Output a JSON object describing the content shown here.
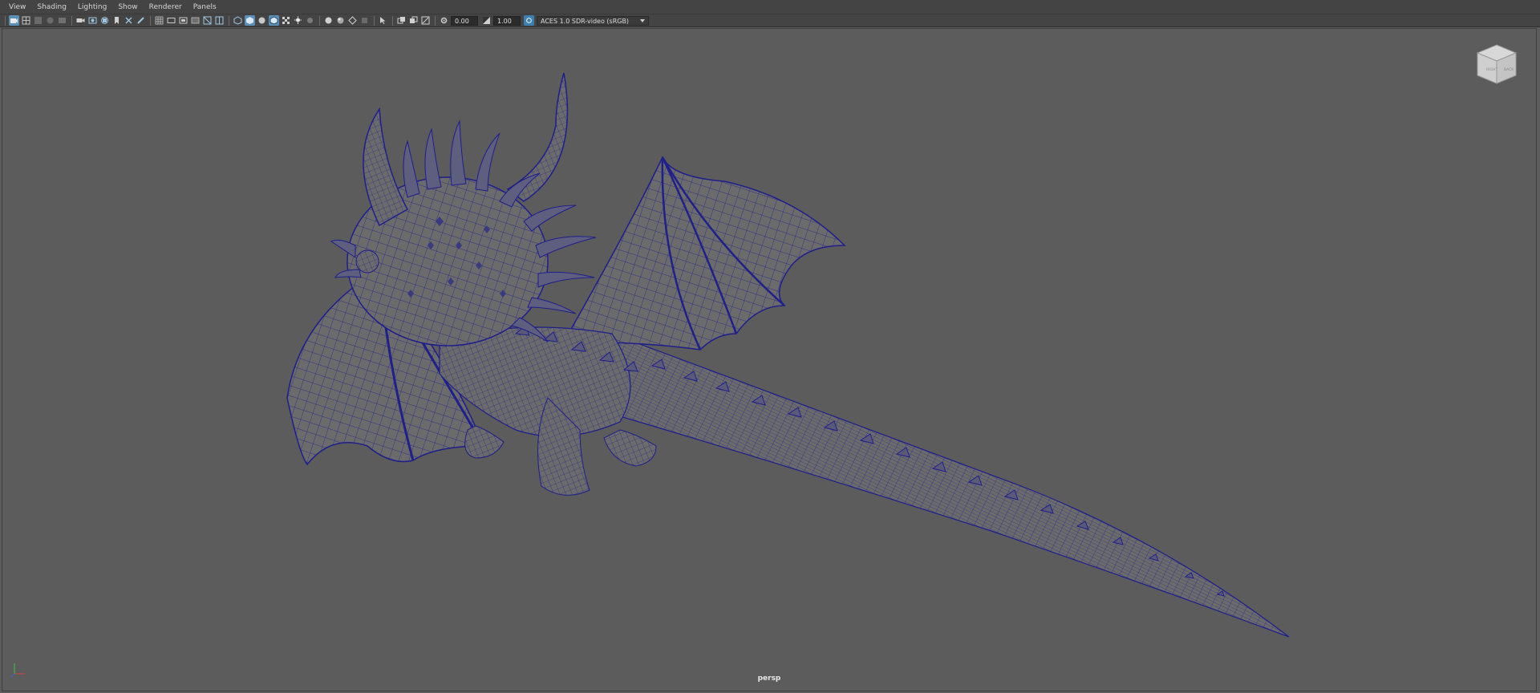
{
  "menu": {
    "items": [
      "View",
      "Shading",
      "Lighting",
      "Show",
      "Renderer",
      "Panels"
    ]
  },
  "toolbar": {
    "icons": [
      "select-camera-icon",
      "camera-attributes-icon",
      "bookmark-icon",
      "image-plane-icon",
      "2d-pan-zoom-icon",
      "grease-pencil-icon",
      "grid-icon",
      "film-gate-icon",
      "resolution-gate-icon",
      "gate-mask-icon",
      "field-chart-icon",
      "safe-action-icon",
      "wireframe-icon",
      "smooth-shade-icon",
      "default-material-icon",
      "wireframe-on-shaded-icon",
      "textured-icon",
      "use-lights-icon",
      "shadows-icon",
      "ambient-occlusion-icon",
      "motion-blur-icon",
      "anti-aliasing-icon",
      "depth-of-field-icon",
      "isolate-select-icon",
      "xray-icon",
      "xray-joints-icon",
      "backface-culling-icon"
    ],
    "exposure_value": "0.00",
    "gamma_value": "1.00",
    "color_management": {
      "view_transform": "ACES 1.0 SDR-video (sRGB)"
    }
  },
  "viewport": {
    "camera_label": "persp",
    "viewcube": {
      "faces": [
        "RIGHT",
        "BACK"
      ]
    },
    "accent_colors": {
      "background": "#5c5c5c",
      "wireframe": "#1e1e8c",
      "mesh_fill": "#6b6b6b",
      "active_button": "#5a8fb6"
    }
  }
}
